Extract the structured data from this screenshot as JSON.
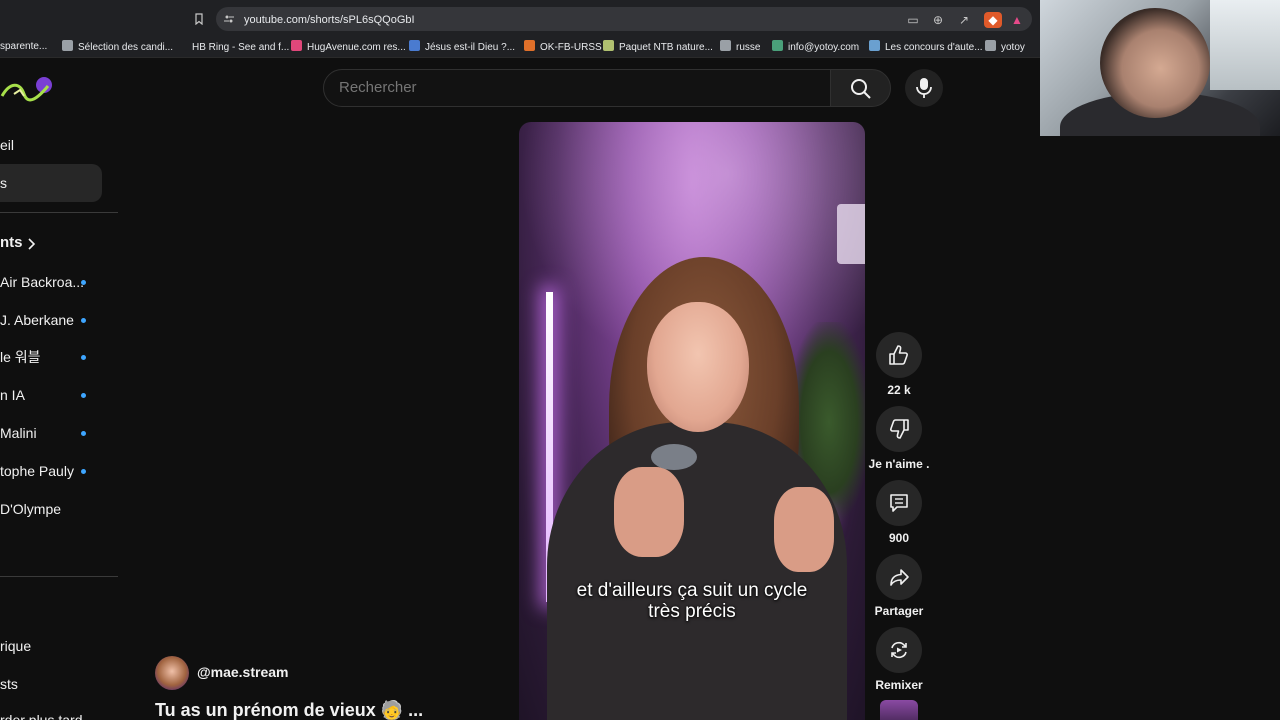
{
  "browser": {
    "url": "youtube.com/shorts/sPL6sQQoGbI",
    "bookmarks": [
      {
        "label": "sparente...",
        "color": "#6b6b6b"
      },
      {
        "label": "Sélection des candi...",
        "color": "#9aa0a6"
      },
      {
        "label": "HB Ring - See and f...",
        "color": "#202124"
      },
      {
        "label": "HugAvenue.com res...",
        "color": "#e0477a"
      },
      {
        "label": "Jésus est-il Dieu ?...",
        "color": "#4a7bd0"
      },
      {
        "label": "OK-FB-URSS",
        "color": "#e0702a"
      },
      {
        "label": "Paquet NTB nature...",
        "color": "#b0c070"
      },
      {
        "label": "russe",
        "color": "#9aa0a6"
      },
      {
        "label": "info@yotoy.com",
        "color": "#4aa07a"
      },
      {
        "label": "Les concours d'aute...",
        "color": "#6aa0d0"
      },
      {
        "label": "yotoy",
        "color": "#9aa0a6"
      }
    ]
  },
  "search": {
    "placeholder": "Rechercher"
  },
  "sidebar": {
    "home": "eil",
    "shorts": "s",
    "subscriptions": "nts",
    "channels": [
      {
        "label": "Air Backroa...",
        "live_dot": true
      },
      {
        "label": "J. Aberkane",
        "live_dot": true
      },
      {
        "label": "le 워블",
        "live_dot": true
      },
      {
        "label": "n IA",
        "live_dot": true
      },
      {
        "label": "Malini",
        "live_dot": true
      },
      {
        "label": "tophe Pauly",
        "live_dot": true
      },
      {
        "label": "D'Olympe",
        "live_dot": false
      }
    ],
    "history": "rique",
    "playlists": "sts",
    "watch_later": "rder plus tard"
  },
  "video": {
    "caption_line1": "et d'ailleurs ça suit un cycle",
    "caption_line2": "très précis"
  },
  "actions": {
    "likes": "22 k",
    "dislike_label": "Je n'aime .",
    "comments": "900",
    "share_label": "Partager",
    "remix_label": "Remixer"
  },
  "channel": {
    "handle": "@mae.stream"
  },
  "short": {
    "title": "Tu as un prénom de vieux 🧓 ..."
  }
}
